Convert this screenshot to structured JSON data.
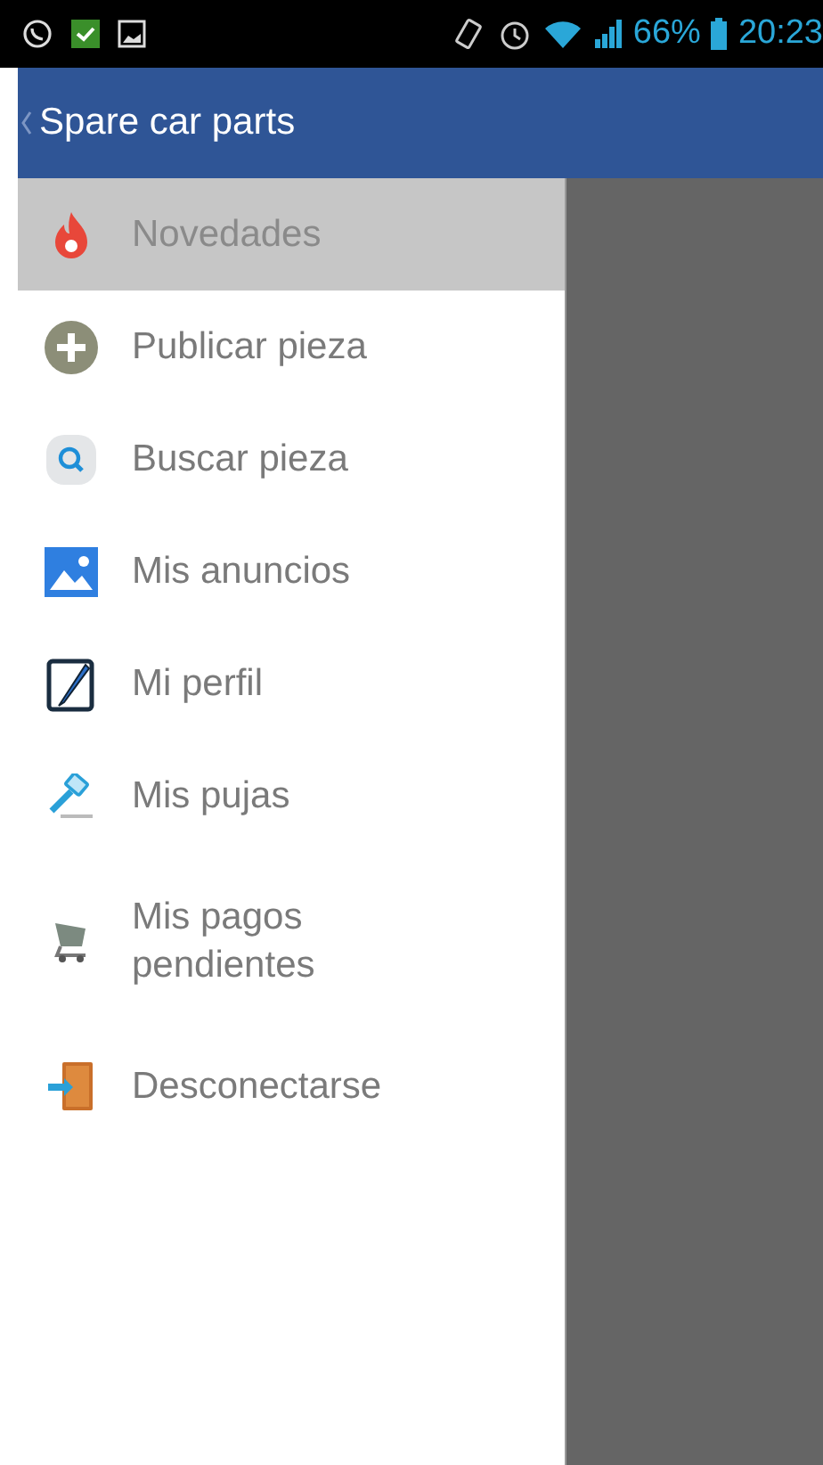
{
  "status_bar": {
    "battery_text": "66%",
    "time": "20:23"
  },
  "app_bar": {
    "title": "Spare car parts"
  },
  "drawer": {
    "items": [
      {
        "label": "Novedades",
        "selected": true
      },
      {
        "label": "Publicar pieza",
        "selected": false
      },
      {
        "label": "Buscar pieza",
        "selected": false
      },
      {
        "label": "Mis anuncios",
        "selected": false
      },
      {
        "label": "Mi perfil",
        "selected": false
      },
      {
        "label": "Mis pujas",
        "selected": false
      },
      {
        "label": "Mis pagos pendientes",
        "selected": false
      },
      {
        "label": "Desconectarse",
        "selected": false
      }
    ]
  }
}
